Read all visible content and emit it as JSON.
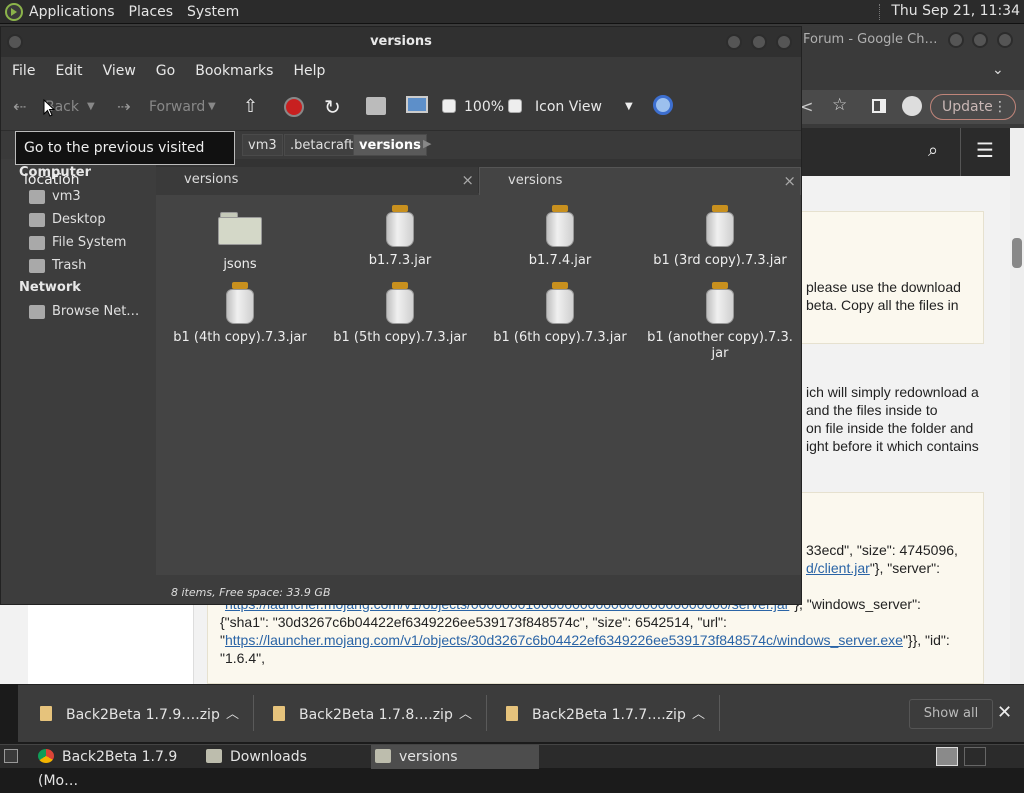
{
  "top_panel": {
    "menus": [
      "Applications",
      "Places",
      "System"
    ],
    "clock": "Thu Sep 21, 11:34"
  },
  "chrome": {
    "window_title": "Forum - Google Ch…",
    "update_label": "Update",
    "web_text": {
      "block1_line1": "please use the download",
      "block1_line2": "beta. Copy all the files in",
      "p2_line1": "ich will simply redownload a",
      "p2_line2": "and the files inside to",
      "p2_line3": "on file inside the folder and",
      "p2_line4": "ight before it which contains",
      "code_line1": "33ecd\", \"size\": 4745096,",
      "code_line2_link": "d/client.jar",
      "code_line2_rest": "\"}, \"server\":",
      "code_line3_link": "https://launcher.mojang.com/v1/objects/000000010000000000000000000000000/server.jar",
      "code_line3_rest": "\"}, \"windows_server\":",
      "code_line4": "{\"sha1\": \"30d3267c6b04422ef6349226ee539173f848574c\", \"size\": 6542514, \"url\":",
      "code_line5_prefix": "\"",
      "code_line5_link": "https://launcher.mojang.com/v1/objects/30d3267c6b04422ef6349226ee539173f848574c/windows_server.exe",
      "code_line5_rest": "\"}}, \"id\":",
      "code_line6": "\"1.6.4\","
    }
  },
  "file_manager": {
    "title": "versions",
    "menus": [
      "File",
      "Edit",
      "View",
      "Go",
      "Bookmarks",
      "Help"
    ],
    "toolbar": {
      "back": "Back",
      "forward": "Forward",
      "zoom": "100%",
      "view_mode": "Icon View"
    },
    "tooltip": "Go to the previous visited location",
    "path": [
      "vm3",
      ".betacraft",
      "versions"
    ],
    "sidebar": {
      "computer_heading": "Computer",
      "computer_items": [
        "vm3",
        "Desktop",
        "File System",
        "Trash"
      ],
      "network_heading": "Network",
      "network_items": [
        "Browse Net…"
      ]
    },
    "tabs": [
      "versions",
      "versions"
    ],
    "files": [
      {
        "name": "jsons",
        "type": "folder"
      },
      {
        "name": "b1.7.3.jar",
        "type": "jar"
      },
      {
        "name": "b1.7.4.jar",
        "type": "jar"
      },
      {
        "name": "b1 (3rd copy).7.3.jar",
        "type": "jar"
      },
      {
        "name": "b1 (4th copy).7.3.jar",
        "type": "jar"
      },
      {
        "name": "b1 (5th copy).7.3.jar",
        "type": "jar"
      },
      {
        "name": "b1 (6th copy).7.3.jar",
        "type": "jar"
      },
      {
        "name_line1": "b1 (another copy).7.3.",
        "name_line2": "jar",
        "type": "jar"
      }
    ],
    "status": "8 items, Free space: 33.9 GB"
  },
  "downloads": {
    "items": [
      "Back2Beta 1.7.9….zip",
      "Back2Beta 1.7.8….zip",
      "Back2Beta 1.7.7….zip"
    ],
    "show_all": "Show all"
  },
  "taskbar": {
    "items": [
      "Back2Beta 1.7.9 (Mo…",
      "Downloads",
      "versions"
    ]
  }
}
